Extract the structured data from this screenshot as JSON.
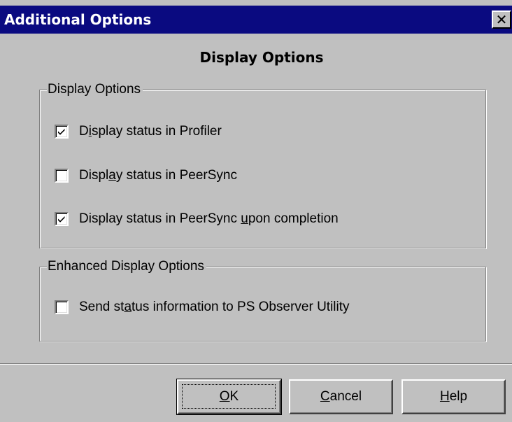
{
  "window": {
    "title": "Additional Options",
    "close_glyph": "✕"
  },
  "heading": "Display Options",
  "groups": [
    {
      "title": "Display Options",
      "items": [
        {
          "label_pre": "D",
          "label_key": "i",
          "label_post": "splay status in Profiler",
          "checked": true
        },
        {
          "label_pre": "Displ",
          "label_key": "a",
          "label_post": "y status in PeerSync",
          "checked": false
        },
        {
          "label_pre": "Display status in PeerSync ",
          "label_key": "u",
          "label_post": "pon completion",
          "checked": true
        }
      ]
    },
    {
      "title": "Enhanced Display Options",
      "items": [
        {
          "label_pre": "Send st",
          "label_key": "a",
          "label_post": "tus information to PS Observer Utility",
          "checked": false
        }
      ]
    }
  ],
  "buttons": {
    "ok": {
      "key": "O",
      "rest": "K"
    },
    "cancel": {
      "key": "C",
      "rest": "ancel"
    },
    "help": {
      "key": "H",
      "rest": "elp"
    }
  },
  "icons": {
    "close": "close-icon",
    "check": "checkmark-icon"
  },
  "colors": {
    "titlebar": "#0a0a80",
    "face": "#c0c0c0",
    "shadow": "#808080",
    "highlight": "#ffffff"
  }
}
